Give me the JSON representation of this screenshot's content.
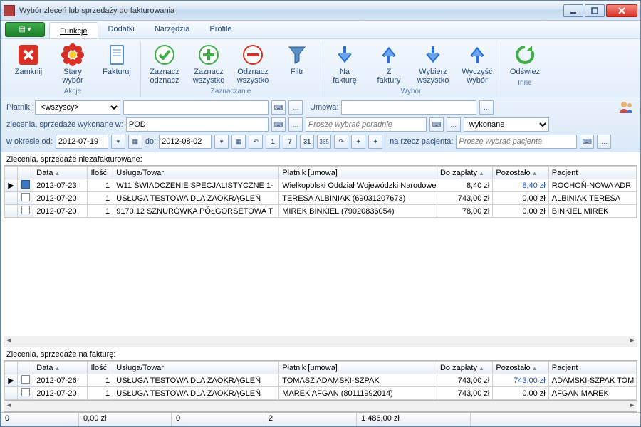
{
  "window": {
    "title": "Wybór zleceń lub sprzedaży do fakturowania"
  },
  "menu": {
    "tabs": [
      "Funkcje",
      "Dodatki",
      "Narzędzia",
      "Profile"
    ],
    "active": 0
  },
  "ribbon": {
    "groups": [
      {
        "label": "Akcje",
        "items": [
          {
            "name": "Zamknij",
            "icon": "close-red"
          },
          {
            "name": "Stary wybór",
            "icon": "flower"
          },
          {
            "name": "Fakturuj",
            "icon": "doc"
          }
        ]
      },
      {
        "label": "Zaznaczanie",
        "items": [
          {
            "name": "Zaznacz odznacz",
            "icon": "check"
          },
          {
            "name": "Zaznacz wszystko",
            "icon": "plus"
          },
          {
            "name": "Odznacz wszystko",
            "icon": "minus"
          },
          {
            "name": "Filtr",
            "icon": "funnel"
          }
        ]
      },
      {
        "label": "Wybór",
        "items": [
          {
            "name": "Na fakturę",
            "icon": "arrow-down"
          },
          {
            "name": "Z faktury",
            "icon": "arrow-up"
          },
          {
            "name": "Wybierz wszystko",
            "icon": "arrow-down"
          },
          {
            "name": "Wyczyść wybór",
            "icon": "arrow-up"
          }
        ]
      },
      {
        "label": "Inne",
        "items": [
          {
            "name": "Odśwież",
            "icon": "refresh"
          }
        ]
      }
    ]
  },
  "filters": {
    "platnik_label": "Płatnik:",
    "platnik_value": "<wszyscy>",
    "umowa_label": "Umowa:",
    "umowa_value": "",
    "line2_label": "zlecenia, sprzedaże wykonane w:",
    "line2_value": "POD",
    "poradnia_placeholder": "Proszę wybrać poradnię",
    "status_value": "wykonane",
    "okres_label": "w okresie od:",
    "date_from": "2012-07-19",
    "do_label": "do:",
    "date_to": "2012-08-02",
    "pacjent_label": "na rzecz pacjenta:",
    "pacjent_placeholder": "Proszę wybrać pacjenta"
  },
  "grids": {
    "top_label": "Zlecenia, sprzedaże niezafakturowane:",
    "bottom_label": "Zlecenia, sprzedaże na fakturę:",
    "columns": [
      "Data",
      "Ilość",
      "Usługa/Towar",
      "Płatnik [umowa]",
      "Do zapłaty",
      "Pozostało",
      "Pacjent"
    ],
    "top_rows": [
      {
        "sel": true,
        "data": "2012-07-23",
        "ilosc": "1",
        "usluga": "W11 ŚWIADCZENIE SPECJALISTYCZNE 1-",
        "platnik": "Wielkopolski Oddział Wojewódzki Narodowego Fundu",
        "do": "8,40 zł",
        "poz": "8,40 zł",
        "pozblue": true,
        "pac": "ROCHOŃ-NOWA ADR"
      },
      {
        "sel": false,
        "data": "2012-07-20",
        "ilosc": "1",
        "usluga": "USŁUGA TESTOWA DLA ZAOKRĄGLEŃ",
        "platnik": "TERESA ALBINIAK (69031207673)",
        "do": "743,00 zł",
        "poz": "0,00 zł",
        "pozblue": false,
        "pac": "ALBINIAK TERESA"
      },
      {
        "sel": false,
        "data": "2012-07-20",
        "ilosc": "1",
        "usluga": "9170.12 SZNURÓWKA PÓŁGORSETOWA T",
        "platnik": "MIREK BINKIEL (79020836054)",
        "do": "78,00 zł",
        "poz": "0,00 zł",
        "pozblue": false,
        "pac": "BINKIEL MIREK"
      }
    ],
    "bottom_rows": [
      {
        "sel": false,
        "data": "2012-07-26",
        "ilosc": "1",
        "usluga": "USŁUGA TESTOWA DLA ZAOKRĄGLEŃ",
        "platnik": "TOMASZ ADAMSKI-SZPAK",
        "do": "743,00 zł",
        "poz": "743,00 zł",
        "pozblue": true,
        "pac": "ADAMSKI-SZPAK TOM"
      },
      {
        "sel": false,
        "data": "2012-07-20",
        "ilosc": "1",
        "usluga": "USŁUGA TESTOWA DLA ZAOKRĄGLEŃ",
        "platnik": "MAREK AFGAN (80111992014)",
        "do": "743,00 zł",
        "poz": "0,00 zł",
        "pozblue": false,
        "pac": "AFGAN MAREK"
      }
    ]
  },
  "status": {
    "c1": "0",
    "c2": "0,00 zł",
    "c3": "0",
    "c4": "2",
    "c5": "1 486,00 zł"
  }
}
